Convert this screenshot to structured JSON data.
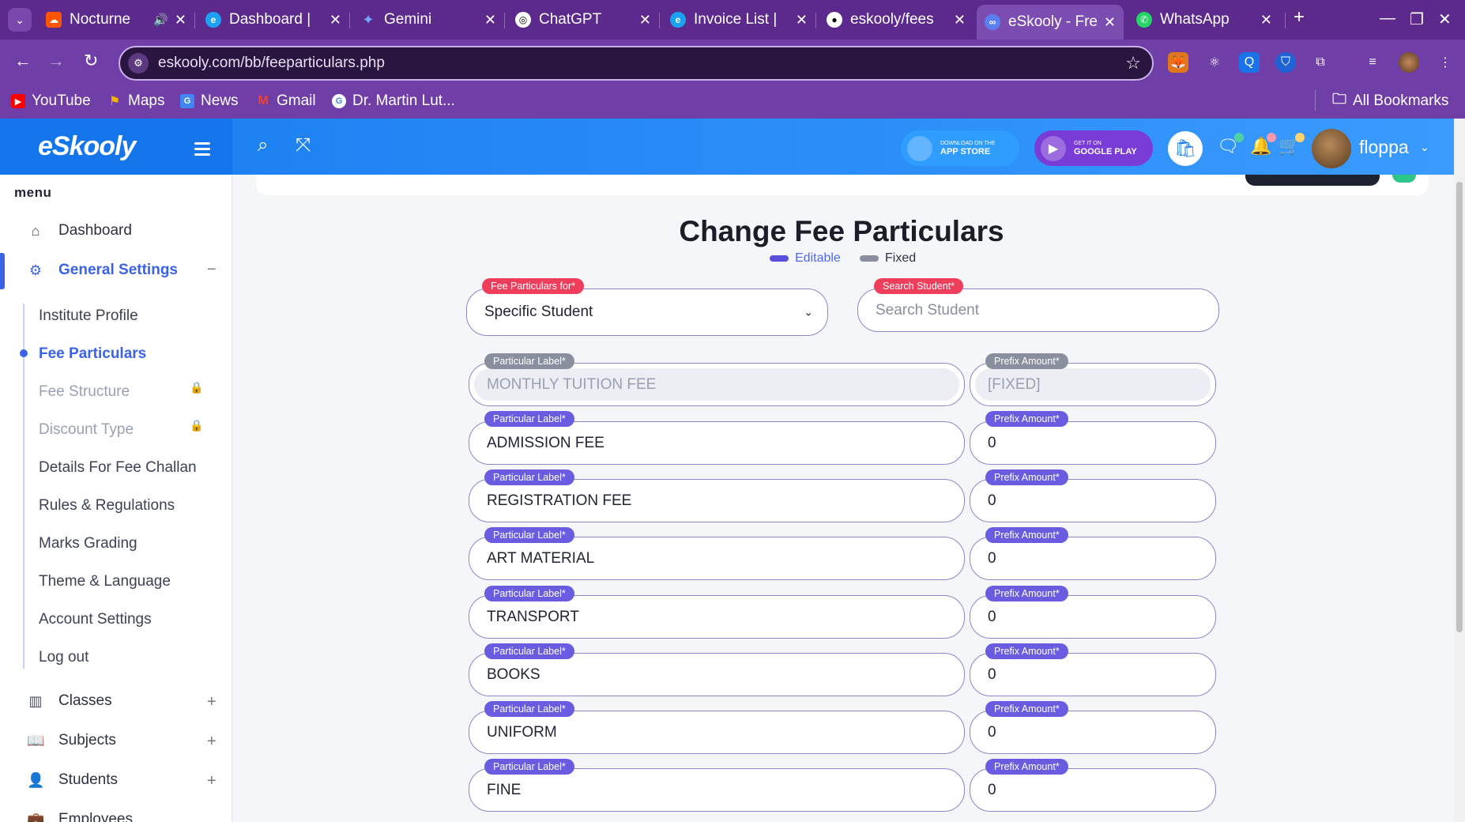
{
  "browser": {
    "tabs": [
      {
        "title": "Nocturne",
        "icon": "soundcloud-icon",
        "color": "#ff5500",
        "has_audio": true
      },
      {
        "title": "Dashboard |",
        "icon": "edge-icon",
        "color": "#1da1f2"
      },
      {
        "title": "Gemini",
        "icon": "gemini-icon",
        "color": "#4285f4"
      },
      {
        "title": "ChatGPT",
        "icon": "chatgpt-icon",
        "color": "#ffffff"
      },
      {
        "title": "Invoice List |",
        "icon": "edge-icon",
        "color": "#1da1f2"
      },
      {
        "title": "eskooly/fees",
        "icon": "github-icon",
        "color": "#ffffff"
      },
      {
        "title": "eSkooly - Fre",
        "icon": "eskooly-icon",
        "color": "#7b4db0",
        "active": true
      },
      {
        "title": "WhatsApp",
        "icon": "whatsapp-icon",
        "color": "#25d366"
      }
    ],
    "url": "eskooly.com/bb/feeparticulars.php",
    "bookmarks": [
      {
        "label": "YouTube",
        "icon": "youtube-icon",
        "color": "#ff0000"
      },
      {
        "label": "Maps",
        "icon": "maps-icon",
        "color": "#34a853"
      },
      {
        "label": "News",
        "icon": "news-icon",
        "color": "#4285f4"
      },
      {
        "label": "Gmail",
        "icon": "gmail-icon",
        "color": "#ea4335"
      },
      {
        "label": "Dr. Martin Lut...",
        "icon": "google-icon",
        "color": "#ffffff"
      }
    ],
    "all_bookmarks": "All Bookmarks"
  },
  "header": {
    "logo_text": "eSkooly",
    "app_store": {
      "small": "DOWNLOAD ON THE",
      "big": "APP STORE"
    },
    "google_play": {
      "small": "GET IT ON",
      "big": "GOOGLE PLAY"
    },
    "user_name": "floppa"
  },
  "sidebar": {
    "title": "menu",
    "dashboard": "Dashboard",
    "general_settings": "General Settings",
    "sub_items": [
      {
        "label": "Institute Profile",
        "state": "normal"
      },
      {
        "label": "Fee Particulars",
        "state": "active"
      },
      {
        "label": "Fee Structure",
        "state": "locked"
      },
      {
        "label": "Discount Type",
        "state": "locked"
      },
      {
        "label": "Details For Fee Challan",
        "state": "normal"
      },
      {
        "label": "Rules & Regulations",
        "state": "normal"
      },
      {
        "label": "Marks Grading",
        "state": "normal"
      },
      {
        "label": "Theme & Language",
        "state": "normal"
      },
      {
        "label": "Account Settings",
        "state": "normal"
      },
      {
        "label": "Log out",
        "state": "normal"
      }
    ],
    "classes": "Classes",
    "subjects": "Subjects",
    "students": "Students",
    "employees": "Employees"
  },
  "main": {
    "title": "Change Fee Particulars",
    "legend_editable": "Editable",
    "legend_fixed": "Fixed",
    "fee_for_label": "Fee Particulars for*",
    "fee_for_value": "Specific Student",
    "search_label": "Search Student*",
    "search_placeholder": "Search Student",
    "particular_label": "Particular Label*",
    "prefix_label": "Prefix Amount*",
    "rows": [
      {
        "label": "MONTHLY TUITION FEE",
        "amount": "[FIXED]",
        "fixed": true
      },
      {
        "label": "ADMISSION FEE",
        "amount": "0"
      },
      {
        "label": "REGISTRATION FEE",
        "amount": "0"
      },
      {
        "label": "ART MATERIAL",
        "amount": "0"
      },
      {
        "label": "TRANSPORT",
        "amount": "0"
      },
      {
        "label": "BOOKS",
        "amount": "0"
      },
      {
        "label": "UNIFORM",
        "amount": "0"
      },
      {
        "label": "FINE",
        "amount": "0"
      }
    ]
  },
  "colors": {
    "accent": "#3a63e6",
    "badge_red": "#ef3e5c",
    "badge_purple": "#6a5ce0",
    "header_blue": "#1a7df0",
    "browser_purple": "#6f3ea6"
  }
}
